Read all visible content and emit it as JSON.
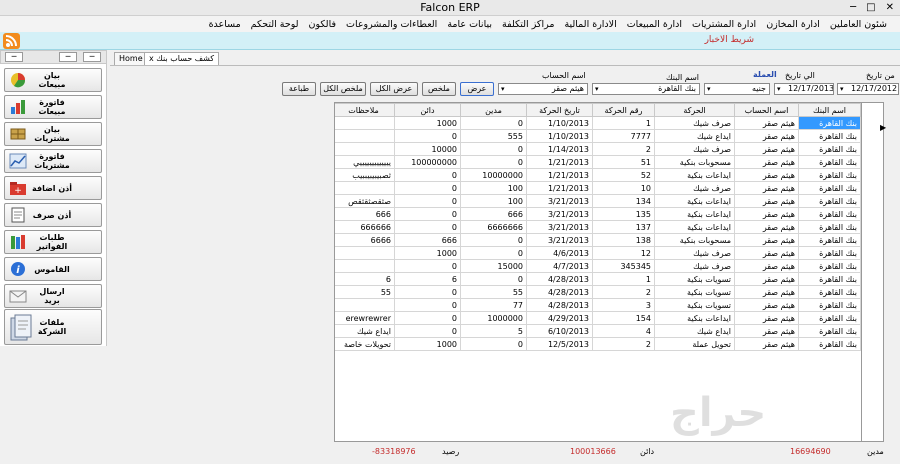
{
  "window": {
    "title": "Falcon ERP",
    "minimize_glyph": "─",
    "maximize_glyph": "□",
    "close_glyph": "✕"
  },
  "menu": [
    "شئون العاملين",
    "ادارة المخازن",
    "ادارة المشتريات",
    "ادارة المبيعات",
    "الادارة المالية",
    "مراكز التكلفة",
    "بيانات عامة",
    "العطاءات والمشروعات",
    "فالكون",
    "لوحة التحكم",
    "مساعدة"
  ],
  "news_bar": {
    "label": "شريط الاخبار",
    "icon": "rss-icon"
  },
  "left_panel": {
    "pin_glyph": "─",
    "min_glyph": "─",
    "close_glyph": "─"
  },
  "sidebar": [
    {
      "label": "بيان مبيعات",
      "icon": "pie-chart-icon"
    },
    {
      "label": "فاتورة مبيعات",
      "icon": "bar-chart-icon"
    },
    {
      "label": "بيان مشتريات",
      "icon": "cart-icon"
    },
    {
      "label": "فاتورة مشتريات",
      "icon": "line-chart-icon"
    },
    {
      "label": "أذن اضافة",
      "icon": "folder-add-icon"
    },
    {
      "label": "أذن صرف",
      "icon": "document-icon"
    },
    {
      "label": "طلبات الفواتير",
      "icon": "books-icon"
    },
    {
      "label": "القاموس",
      "icon": "info-icon"
    },
    {
      "label": "ارسال بريد",
      "icon": "mail-icon"
    },
    {
      "label": "ملفات الشركة",
      "icon": "files-icon"
    }
  ],
  "tabs": {
    "home": "Home",
    "active": "كشف حساب بنك",
    "close_glyph": "x"
  },
  "filters": {
    "from_date_label": "من تاريخ",
    "from_date": "12/17/2012",
    "to_date_label": "الي تاريخ",
    "to_date": "12/17/2013",
    "currency_label": "العملة",
    "currency": "جنيه",
    "bank_label": "اسم البنك",
    "bank": "بنك القاهرة",
    "account_label": "اسم الحساب",
    "account": "هيثم صقر",
    "dropdown_glyph": "▾"
  },
  "buttons": {
    "show": "عرض",
    "summary": "ملخص",
    "show_all": "عرض الكل",
    "summary_all": "ملخص الكل",
    "print": "طباعة"
  },
  "grid": {
    "columns": [
      "اسم البنك",
      "اسم الحساب",
      "الحركة",
      "رقم الحركة",
      "تاريخ الحركة",
      "مدين",
      "دائن",
      "ملاحظات"
    ],
    "rows": [
      [
        "بنك القاهرة",
        "هيثم صقر",
        "صرف شيك",
        "1",
        "1/10/2013",
        "0",
        "1000",
        ""
      ],
      [
        "بنك القاهرة",
        "هيثم صقر",
        "ايداع شيك",
        "7777",
        "1/10/2013",
        "555",
        "0",
        ""
      ],
      [
        "بنك القاهرة",
        "هيثم صقر",
        "صرف شيك",
        "2",
        "1/14/2013",
        "0",
        "10000",
        ""
      ],
      [
        "بنك القاهرة",
        "هيثم صقر",
        "مسحوبات بنكية",
        "51",
        "1/21/2013",
        "0",
        "100000000",
        "يييييييييييييي"
      ],
      [
        "بنك القاهرة",
        "هيثم صقر",
        "ايداعات بنكية",
        "52",
        "1/21/2013",
        "10000000",
        "0",
        "ثصبيبيبيببيب"
      ],
      [
        "بنك القاهرة",
        "هيثم صقر",
        "صرف شيك",
        "10",
        "1/21/2013",
        "100",
        "0",
        ""
      ],
      [
        "بنك القاهرة",
        "هيثم صقر",
        "ايداعات بنكية",
        "134",
        "3/21/2013",
        "100",
        "0",
        "صثقصثقثقص"
      ],
      [
        "بنك القاهرة",
        "هيثم صقر",
        "ايداعات بنكية",
        "135",
        "3/21/2013",
        "666",
        "0",
        "666"
      ],
      [
        "بنك القاهرة",
        "هيثم صقر",
        "ايداعات بنكية",
        "137",
        "3/21/2013",
        "6666666",
        "0",
        "666666"
      ],
      [
        "بنك القاهرة",
        "هيثم صقر",
        "مسحوبات بنكية",
        "138",
        "3/21/2013",
        "0",
        "666",
        "6666"
      ],
      [
        "بنك القاهرة",
        "هيثم صقر",
        "صرف شيك",
        "12",
        "4/6/2013",
        "0",
        "1000",
        ""
      ],
      [
        "بنك القاهرة",
        "هيثم صقر",
        "صرف شيك",
        "345345",
        "4/7/2013",
        "15000",
        "0",
        ""
      ],
      [
        "بنك القاهرة",
        "هيثم صقر",
        "تسويات بنكية",
        "1",
        "4/28/2013",
        "0",
        "6",
        "6"
      ],
      [
        "بنك القاهرة",
        "هيثم صقر",
        "تسويات بنكية",
        "2",
        "4/28/2013",
        "55",
        "0",
        "55"
      ],
      [
        "بنك القاهرة",
        "هيثم صقر",
        "تسويات بنكية",
        "3",
        "4/28/2013",
        "77",
        "0",
        ""
      ],
      [
        "بنك القاهرة",
        "هيثم صقر",
        "ايداعات بنكية",
        "154",
        "4/29/2013",
        "1000000",
        "0",
        "erewrewrer"
      ],
      [
        "بنك القاهرة",
        "هيثم صقر",
        "ايداع شيك",
        "4",
        "6/10/2013",
        "5",
        "0",
        "ايداع شيك"
      ],
      [
        "بنك القاهرة",
        "هيثم صقر",
        "تحويل عملة",
        "2",
        "12/5/2013",
        "0",
        "1000",
        "تحويلات خاصة"
      ]
    ],
    "row_pointer": "▶"
  },
  "footer": {
    "debit_label": "مدين",
    "debit_value": "16694690",
    "credit_label": "دائن",
    "credit_value": "100013666",
    "balance_label": "رصيد",
    "balance_value": "-83318976"
  },
  "watermark": {
    "text": "حراج"
  },
  "colors": {
    "accent": "#3399ff",
    "news_bg": "#d3f0f7",
    "footer_values": "#c42b2b"
  }
}
